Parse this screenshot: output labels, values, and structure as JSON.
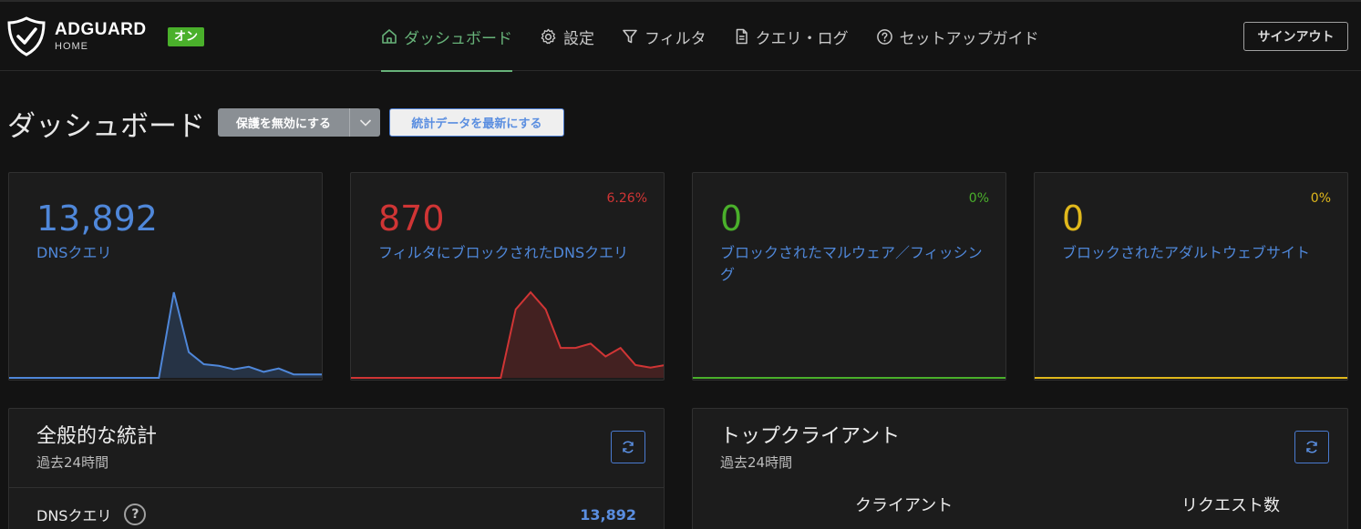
{
  "brand": {
    "name": "ADGUARD",
    "sub": "HOME",
    "status_badge": "オン"
  },
  "nav": [
    {
      "label": "ダッシュボード",
      "icon": "home-icon",
      "active": true
    },
    {
      "label": "設定",
      "icon": "gear-icon",
      "active": false
    },
    {
      "label": "フィルタ",
      "icon": "filter-icon",
      "active": false
    },
    {
      "label": "クエリ・ログ",
      "icon": "document-icon",
      "active": false
    },
    {
      "label": "セットアップガイド",
      "icon": "help-circle-icon",
      "active": false
    }
  ],
  "signout": "サインアウト",
  "page": {
    "title": "ダッシュボード",
    "disable_protection": "保護を無効にする",
    "refresh_stats": "統計データを最新にする"
  },
  "colors": {
    "blue": "#4f87d9",
    "red": "#d03535",
    "green": "#4ab02b",
    "yellow": "#e0b81c",
    "active_nav": "#67b279"
  },
  "cards": [
    {
      "value": "13,892",
      "label": "DNSクエリ",
      "percent": "",
      "color": "#4f87d9",
      "series": [
        0,
        0,
        0,
        0,
        0,
        0,
        0,
        0,
        0,
        0,
        0,
        100,
        30,
        16,
        14,
        10,
        13,
        7,
        11,
        4,
        4,
        4
      ]
    },
    {
      "value": "870",
      "label": "フィルタにブロックされたDNSクエリ",
      "percent": "6.26%",
      "color": "#d03535",
      "series": [
        0,
        0,
        0,
        0,
        0,
        0,
        0,
        0,
        0,
        0,
        0,
        80,
        100,
        80,
        35,
        35,
        40,
        25,
        35,
        15,
        12,
        15
      ]
    },
    {
      "value": "0",
      "label": "ブロックされたマルウェア／フィッシング",
      "percent": "0%",
      "color": "#4ab02b",
      "series": [
        0,
        0,
        0,
        0,
        0,
        0,
        0,
        0,
        0,
        0,
        0,
        0,
        0,
        0,
        0,
        0,
        0,
        0,
        0,
        0,
        0,
        0
      ]
    },
    {
      "value": "0",
      "label": "ブロックされたアダルトウェブサイト",
      "percent": "0%",
      "color": "#e0b81c",
      "series": [
        0,
        0,
        0,
        0,
        0,
        0,
        0,
        0,
        0,
        0,
        0,
        0,
        0,
        0,
        0,
        0,
        0,
        0,
        0,
        0,
        0,
        0
      ]
    }
  ],
  "general_stats": {
    "title": "全般的な統計",
    "subtitle": "過去24時間",
    "rows": [
      {
        "name": "DNSクエリ",
        "value": "13,892"
      }
    ]
  },
  "top_clients": {
    "title": "トップクライアント",
    "subtitle": "過去24時間",
    "columns": [
      "クライアント",
      "リクエスト数"
    ]
  }
}
